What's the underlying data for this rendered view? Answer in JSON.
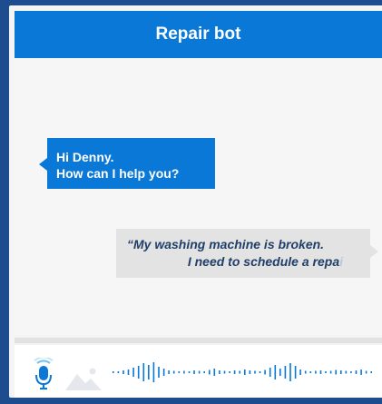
{
  "header": {
    "title": "Repair bot"
  },
  "messages": {
    "bot": {
      "line1": "Hi Denny.",
      "line2": "How can I help you?"
    },
    "user": {
      "line1": "“My washing machine is broken.",
      "line2": "I need to schedule a repa",
      "cursor_char": "i"
    }
  },
  "input_bar": {
    "mic_icon": "microphone-icon",
    "image_icon": "image-icon",
    "waveform_icon": "audio-waveform"
  },
  "colors": {
    "accent": "#0a78d7",
    "background": "#1d4d8f",
    "user_bubble": "#e3e3e3",
    "user_text": "#1f3f68"
  }
}
